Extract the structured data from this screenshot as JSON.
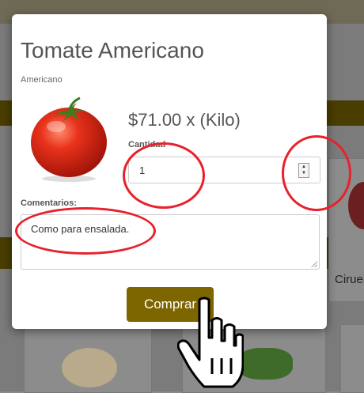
{
  "background": {
    "side_product_label": "Ciruel"
  },
  "modal": {
    "title": "Tomate Americano",
    "subtitle": "Americano",
    "price": "$71.00 x (Kilo)",
    "quantity_label": "Cantidad",
    "quantity_value": "1",
    "comments_label": "Comentarios:",
    "comments_value": "Como para ensalada.",
    "buy_label": "Comprar"
  },
  "colors": {
    "accent": "#7d6500",
    "annotation": "#e8212b"
  },
  "icons": [
    "spinner-icon",
    "hand-cursor-icon",
    "tomato-image"
  ]
}
